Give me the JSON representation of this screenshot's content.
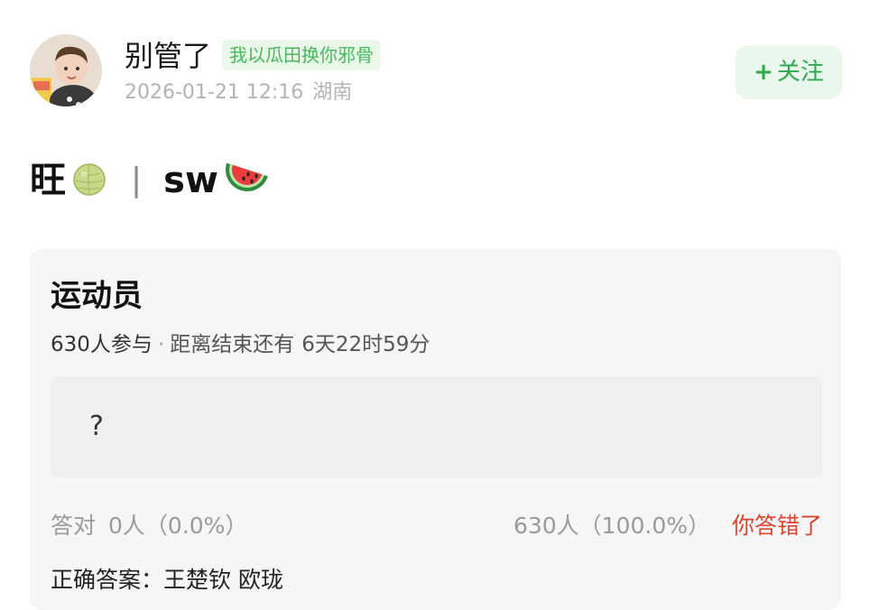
{
  "header": {
    "username": "别管了",
    "tag": "我以瓜田换你邪骨",
    "date": "2026-01-21 12:16",
    "location": "湖南",
    "follow_plus": "+",
    "follow_label": "关注"
  },
  "post": {
    "text_1": "旺",
    "emoji_1": "melon-icon",
    "separator": "|",
    "text_2": "sw",
    "emoji_2": "watermelon-icon"
  },
  "quiz": {
    "title": "运动员",
    "participants": "630人参与",
    "dot": "·",
    "remaining_label": "距离结束还有",
    "remaining_time": "6天22时59分",
    "option_text": "?",
    "correct_label": "答对",
    "correct_count": "0人（0.0%）",
    "wrong_count": "630人（100.0%）",
    "wrong_label": "你答错了",
    "answer_label": "正确答案：王楚钦 欧珑"
  },
  "colors": {
    "brand_green": "#2fa84f",
    "tag_green": "#48b85c",
    "error_red": "#e0452f"
  }
}
